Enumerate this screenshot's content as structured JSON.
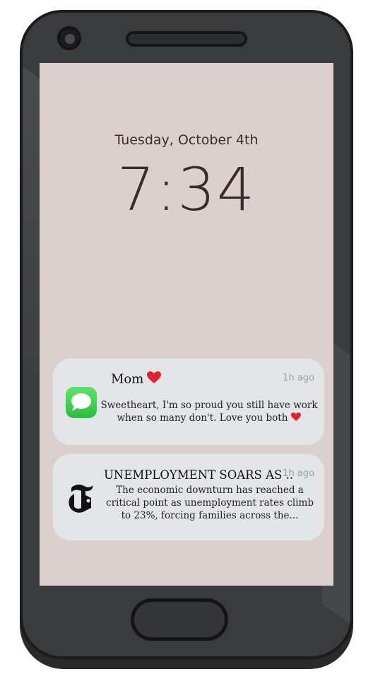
{
  "lockscreen": {
    "date": "Tuesday, October 4th",
    "time": "7:34"
  },
  "notifications": [
    {
      "app_icon": "messages-icon",
      "title": "Mom",
      "title_emoji": "red-heart-icon",
      "time": "1h ago",
      "body": "Sweetheart, I'm so proud you still have work when so many don't. Love you both"
    },
    {
      "app_icon": "nyt-logo-icon",
      "title": "UNEMPLOYMENT SOARS AS ..",
      "time": "1h ago",
      "body": "The economic downturn has reached a critical point as unemployment rates climb to 23%, forcing families across the..."
    }
  ],
  "colors": {
    "screen_bg": "#dcd0cf",
    "phone_body": "#3a3b3d",
    "notification_bg": "#e4e5e8",
    "text_dark": "#3b2b2c",
    "messages_green": "#34c759"
  }
}
